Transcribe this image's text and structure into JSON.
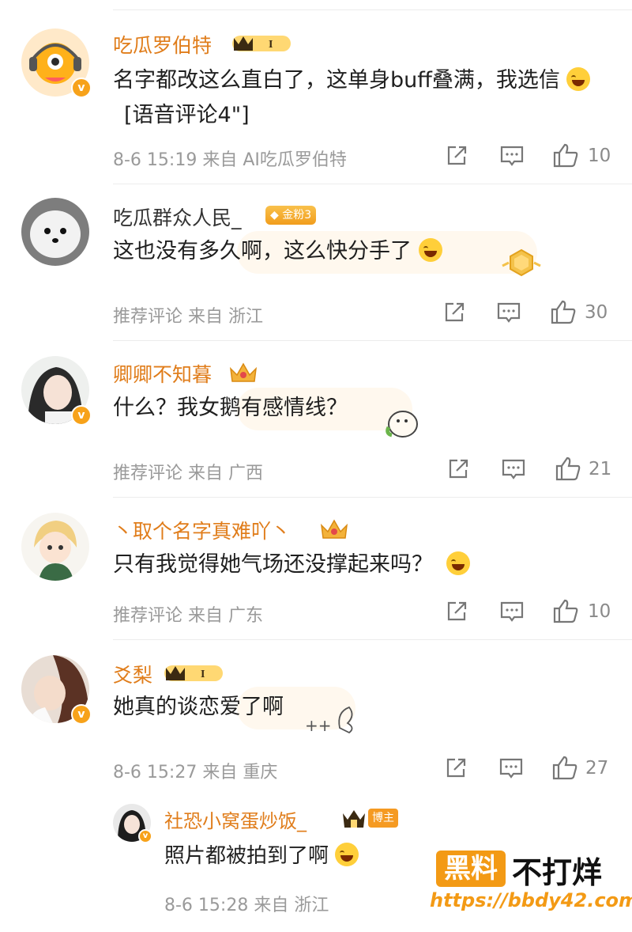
{
  "comments": [
    {
      "username": "吃瓜罗伯特",
      "text": "名字都改这么直白了，这单身buff叠满，我选信",
      "text_tail": "[语音评论4\"]",
      "meta": "8-6 15:19  来自 AI吃瓜罗伯特",
      "likes": "10",
      "badge": "I"
    },
    {
      "username": "吃瓜群众人民_",
      "badge": "金粉3",
      "text": "这也没有多久啊，这么快分手了",
      "meta": "推荐评论  来自 浙江",
      "likes": "30"
    },
    {
      "username": "卿卿不知暮",
      "text": "什么？我女鹅有感情线？",
      "meta": "推荐评论  来自 广西",
      "likes": "21"
    },
    {
      "username": "丶取个名字真难吖丶",
      "text": "只有我觉得她气场还没撑起来吗？",
      "meta": "推荐评论  来自 广东",
      "likes": "10"
    },
    {
      "username": "爻梨",
      "badge": "I",
      "text": "她真的谈恋爱了啊",
      "meta": "8-6 15:27  来自 重庆",
      "likes": "27"
    }
  ],
  "reply": {
    "username": "社恐小窝蛋炒饭_",
    "badge": "博主",
    "text": "照片都被拍到了啊",
    "meta": "8-6 15:28  来自 浙江"
  },
  "watermark": {
    "box_text": "黑料",
    "right_text": "不打烊",
    "url": "https://bbdy42.com"
  },
  "colors": {
    "username_orange": "#e07d1b",
    "meta_gray": "#9a9a9a",
    "badge_gold": "#f5a623",
    "watermark_orange": "#f39a15"
  }
}
